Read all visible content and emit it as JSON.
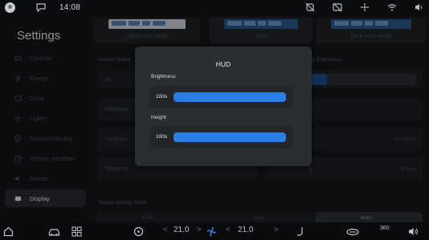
{
  "status_bar": {
    "time": "14:08",
    "icons": [
      "avatar-icon",
      "message-icon",
      "no-signal-icon",
      "screen-off-icon",
      "fan-icon",
      "wifi-icon",
      "volume-icon"
    ]
  },
  "sidebar": {
    "title": "Settings",
    "items": [
      {
        "label": "Controls",
        "icon": "car-icon"
      },
      {
        "label": "Energy",
        "icon": "energy-icon"
      },
      {
        "label": "Drive",
        "icon": "drive-icon"
      },
      {
        "label": "Lights",
        "icon": "lights-icon"
      },
      {
        "label": "Assisted driving",
        "icon": "assist-icon"
      },
      {
        "label": "Vehicle condition",
        "icon": "vehicle-icon"
      },
      {
        "label": "Sound",
        "icon": "sound-icon"
      },
      {
        "label": "Display",
        "icon": "display-icon",
        "active": true
      }
    ]
  },
  "main": {
    "modes": [
      "Light color mode",
      "Auto",
      "Dark color mode"
    ],
    "center_display_label": "Center Displa",
    "overlay_brightness_label": "lay Brightness",
    "brightness_small_value": "6s",
    "wallpaper_label": "Wallpape",
    "wallpaper_right": "D",
    "language_label": "Languag",
    "time_format_value": "UTC+08:00",
    "bottom_label": "Bottom b",
    "clock_label": "g",
    "clock_value": "12 hours",
    "range_display_label": "Range display mode",
    "range_options": [
      "WLTP",
      "SLIM",
      "AEDC"
    ]
  },
  "hud_dialog": {
    "title": "HUD",
    "brightness": {
      "label": "Brightness",
      "value_text": "100s",
      "level": 1.0
    },
    "height": {
      "label": "Height",
      "value_text": "100s",
      "level": 1.0
    }
  },
  "bottom_bar": {
    "left_temp": "21.0",
    "right_temp": "21.0",
    "badge_360": "360"
  },
  "colors": {
    "accent": "#2b7fe4",
    "dialog_bg": "#2a2d31",
    "sidebar_bg": "#141619"
  }
}
